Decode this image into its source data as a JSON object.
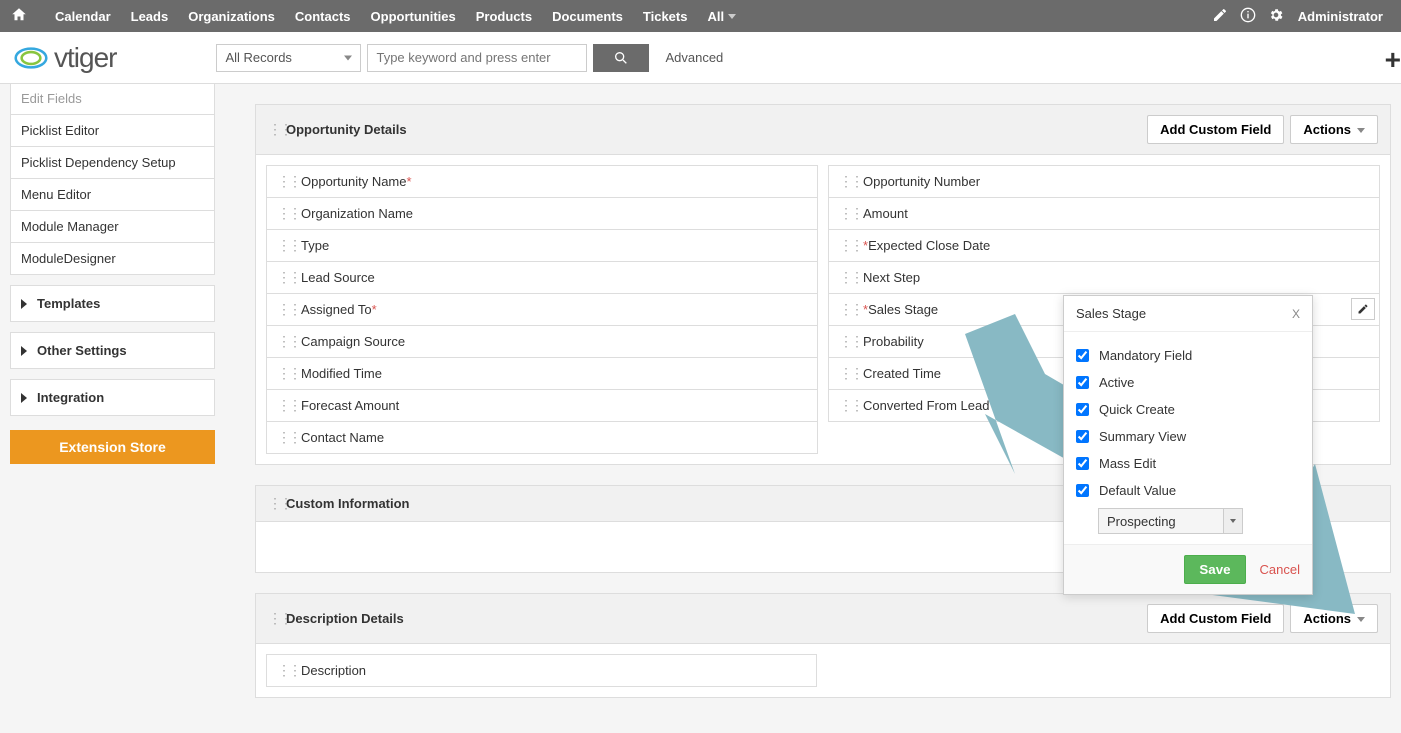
{
  "topnav": {
    "items": [
      "Calendar",
      "Leads",
      "Organizations",
      "Contacts",
      "Opportunities",
      "Products",
      "Documents",
      "Tickets"
    ],
    "all_label": "All",
    "admin": "Administrator"
  },
  "header": {
    "record_scope": "All Records",
    "search_placeholder": "Type keyword and press enter",
    "advanced": "Advanced"
  },
  "sidebar": {
    "cut_item": "Edit Fields",
    "items": [
      "Picklist Editor",
      "Picklist Dependency Setup",
      "Menu Editor",
      "Module Manager",
      "ModuleDesigner"
    ],
    "sections": [
      "Templates",
      "Other Settings",
      "Integration"
    ],
    "ext_btn": "Extension Store"
  },
  "blocks": {
    "opp": {
      "title": "Opportunity Details",
      "add_btn": "Add Custom Field",
      "actions_btn": "Actions",
      "left_fields": [
        {
          "label": "Opportunity Name",
          "required_after": true
        },
        {
          "label": "Organization Name"
        },
        {
          "label": "Type"
        },
        {
          "label": "Lead Source"
        },
        {
          "label": "Assigned To",
          "required_after": true
        },
        {
          "label": "Campaign Source"
        },
        {
          "label": "Modified Time"
        },
        {
          "label": "Forecast Amount"
        },
        {
          "label": "Contact Name"
        }
      ],
      "right_fields": [
        {
          "label": "Opportunity Number"
        },
        {
          "label": "Amount"
        },
        {
          "label": "Expected Close Date",
          "required_before": true
        },
        {
          "label": "Next Step"
        },
        {
          "label": "Sales Stage",
          "required_before": true,
          "active": true
        },
        {
          "label": "Probability"
        },
        {
          "label": "Created Time"
        },
        {
          "label": "Converted From Lead"
        }
      ]
    },
    "custom": {
      "title": "Custom Information"
    },
    "desc": {
      "title": "Description Details",
      "add_btn": "Add Custom Field",
      "actions_btn": "Actions",
      "field": "Description"
    }
  },
  "popover": {
    "title": "Sales Stage",
    "close": "X",
    "checks": [
      "Mandatory Field",
      "Active",
      "Quick Create",
      "Summary View",
      "Mass Edit",
      "Default Value"
    ],
    "default_value": "Prospecting",
    "save": "Save",
    "cancel": "Cancel"
  }
}
